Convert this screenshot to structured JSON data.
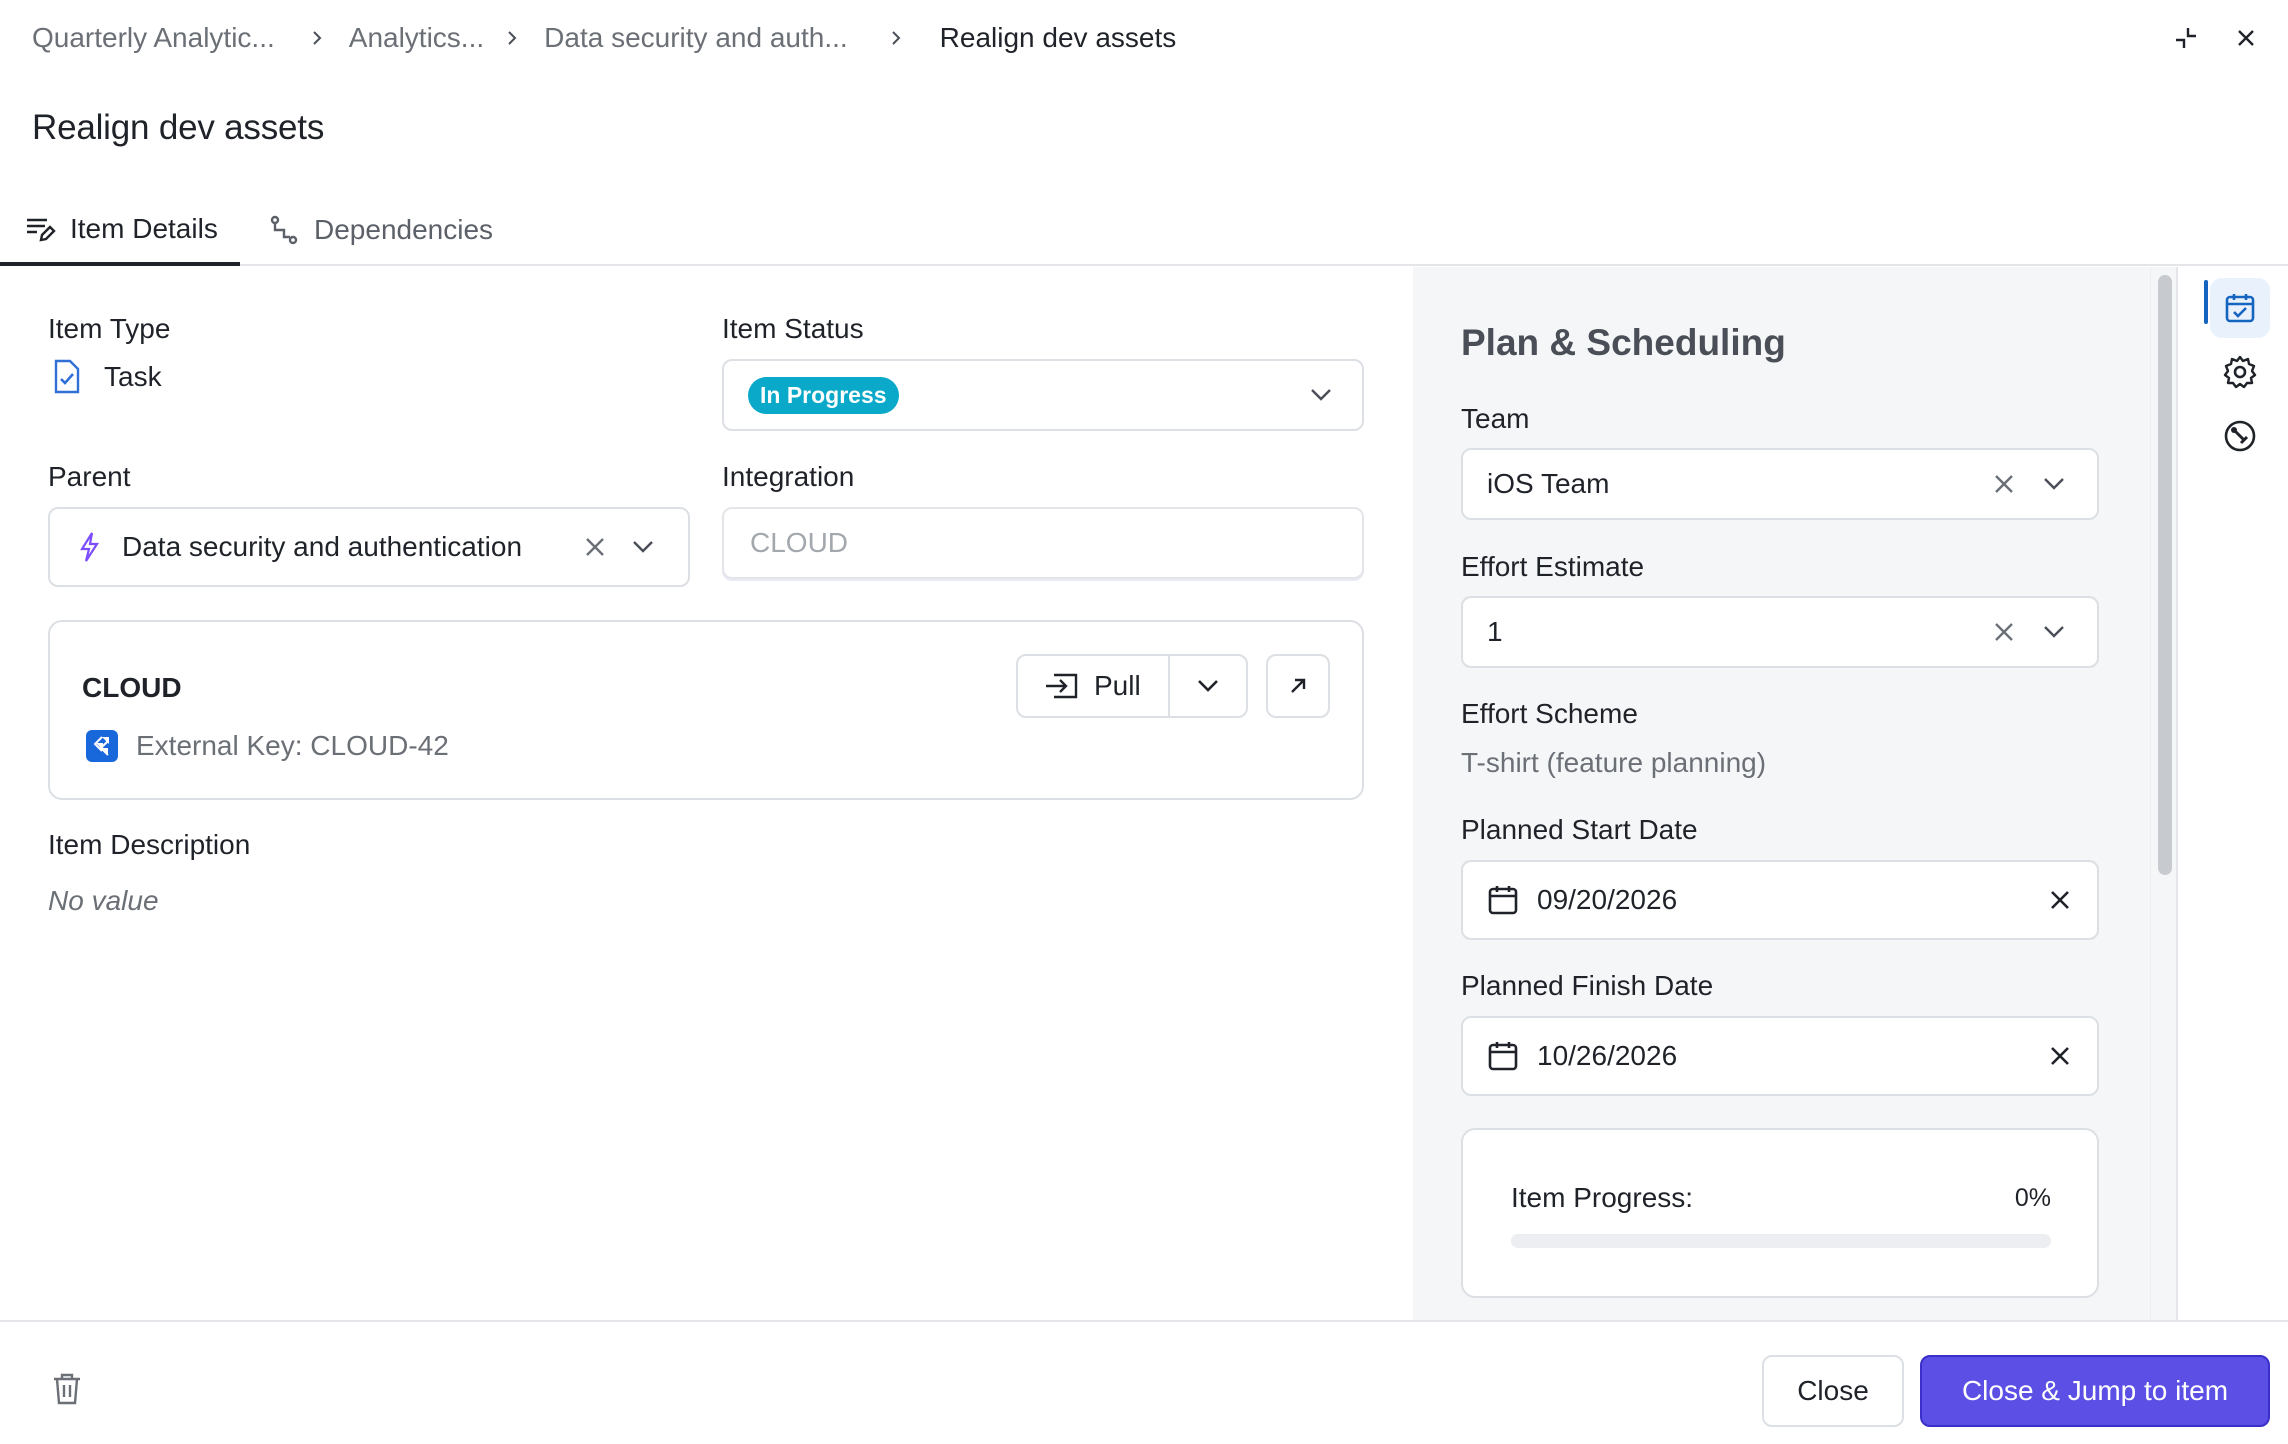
{
  "breadcrumb": {
    "items": [
      "Quarterly Analytic...",
      "Analytics...",
      "Data security and auth..."
    ],
    "current": "Realign dev assets"
  },
  "page": {
    "title": "Realign dev assets"
  },
  "tabs": [
    {
      "label": "Item Details",
      "active": true
    },
    {
      "label": "Dependencies",
      "active": false
    }
  ],
  "details": {
    "item_type_label": "Item Type",
    "item_type_value": "Task",
    "item_status_label": "Item Status",
    "item_status_value": "In Progress",
    "parent_label": "Parent",
    "parent_value": "Data security and authentication",
    "integration_label": "Integration",
    "integration_placeholder": "CLOUD",
    "integration_card": {
      "title": "CLOUD",
      "external_key": "External Key: CLOUD-42",
      "pull_label": "Pull"
    },
    "description_label": "Item Description",
    "description_value": "No value"
  },
  "plan": {
    "title": "Plan & Scheduling",
    "team_label": "Team",
    "team_value": "iOS Team",
    "effort_estimate_label": "Effort Estimate",
    "effort_estimate_value": "1",
    "effort_scheme_label": "Effort Scheme",
    "effort_scheme_value": "T-shirt (feature planning)",
    "start_label": "Planned Start Date",
    "start_value": "09/20/2026",
    "finish_label": "Planned Finish Date",
    "finish_value": "10/26/2026",
    "progress_label": "Item Progress:",
    "progress_text": "0%",
    "progress_fraction": 0
  },
  "footer": {
    "close_label": "Close",
    "jump_label": "Close & Jump to item"
  },
  "colors": {
    "status_badge": "#0aa9c9",
    "primary_button": "#5b4fe6",
    "rail_active": "#1565c0",
    "parent_icon": "#7c4dff",
    "jira_icon": "#1868db"
  }
}
